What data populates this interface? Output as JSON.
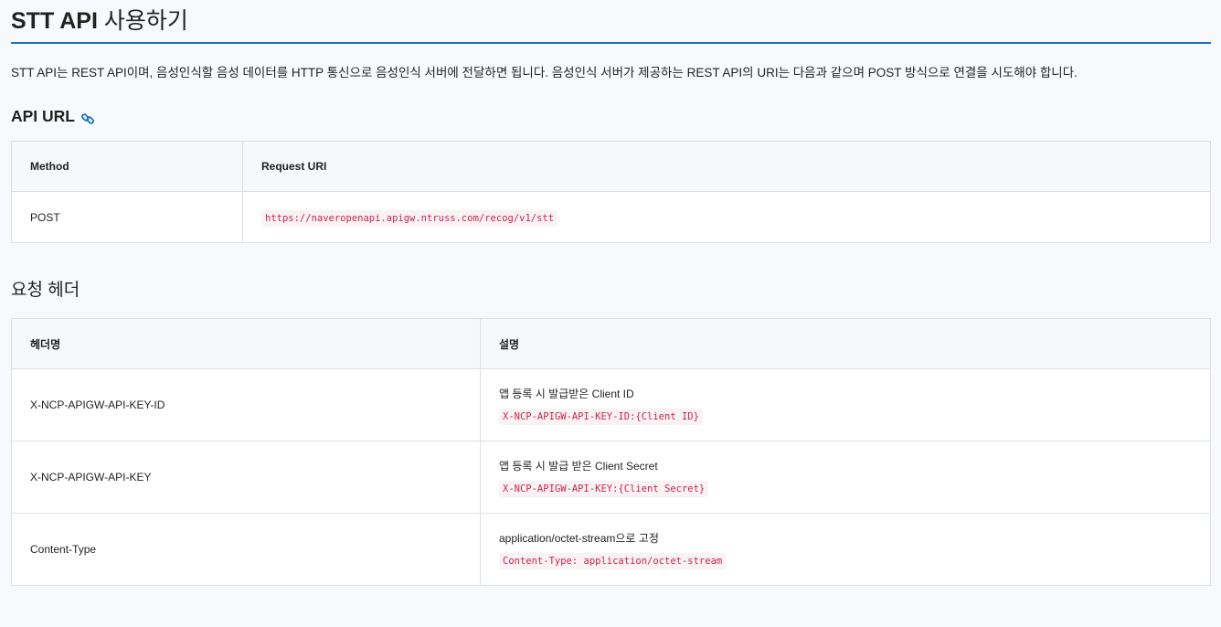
{
  "page": {
    "title_strong": "STT API",
    "title_rest": " 사용하기",
    "intro": "STT API는 REST API이며, 음성인식할 음성 데이터를 HTTP 통신으로 음성인식 서버에 전달하면 됩니다. 음성인식 서버가 제공하는 REST API의 URI는 다음과 같으며 POST 방식으로 연결을 시도해야 합니다."
  },
  "api_url": {
    "heading": "API URL",
    "icon": "link-icon",
    "accent": "#1a73b8",
    "headers": [
      "Method",
      "Request URI"
    ],
    "row": {
      "method": "POST",
      "uri": "https://naveropenapi.apigw.ntruss.com/recog/v1/stt"
    }
  },
  "request_header": {
    "heading": "요청 헤더",
    "headers": [
      "헤더명",
      "설명"
    ],
    "rows": [
      {
        "name": "X-NCP-APIGW-API-KEY-ID",
        "desc": "앱 등록 시 발급받은 Client ID",
        "code": "X-NCP-APIGW-API-KEY-ID:{Client ID}"
      },
      {
        "name": "X-NCP-APIGW-API-KEY",
        "desc": "앱 등록 시 발급 받은 Client Secret",
        "code": "X-NCP-APIGW-API-KEY:{Client Secret}"
      },
      {
        "name": "Content-Type",
        "desc": "application/octet-stream으로 고정",
        "code": "Content-Type: application/octet-stream"
      }
    ]
  }
}
